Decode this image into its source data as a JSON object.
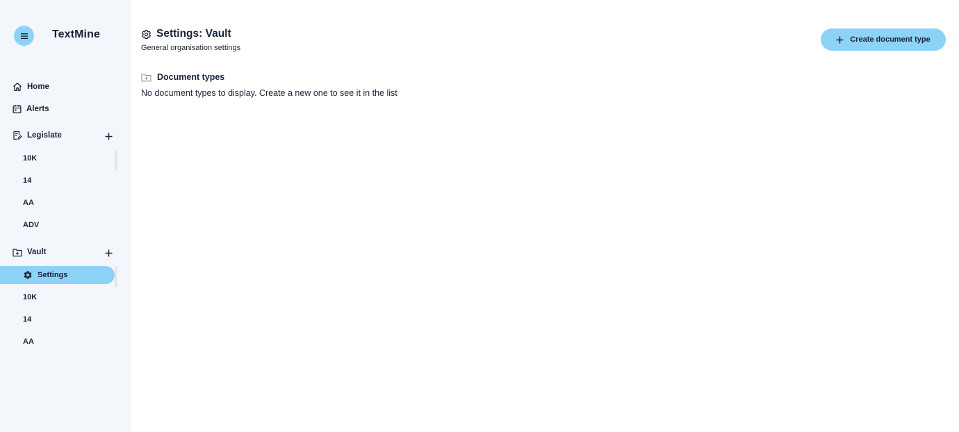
{
  "app": {
    "brand": "TextMine",
    "menu_icon": "hamburger-menu-icon",
    "accent_color": "#8dd3f7"
  },
  "sidebar": {
    "home": {
      "label": "Home",
      "icon": "home-icon"
    },
    "alerts": {
      "label": "Alerts",
      "icon": "calendar-icon"
    },
    "legislate": {
      "label": "Legislate",
      "icon": "document-edit-icon",
      "items": [
        "10K",
        "14",
        "AA",
        "ADV"
      ]
    },
    "vault": {
      "label": "Vault",
      "icon": "folder-add-icon",
      "active": {
        "label": "Settings",
        "icon": "gear-icon"
      },
      "items": [
        "10K",
        "14",
        "AA"
      ]
    }
  },
  "header": {
    "title": "Settings: Vault",
    "subtitle": "General organisation settings",
    "title_icon": "gear-outline-icon"
  },
  "actions": {
    "create_label": "Create document type",
    "create_icon": "plus-icon"
  },
  "document_types": {
    "title": "Document types",
    "icon": "folder-icon",
    "empty_message": "No document types to display. Create a new one to see it in the list"
  }
}
